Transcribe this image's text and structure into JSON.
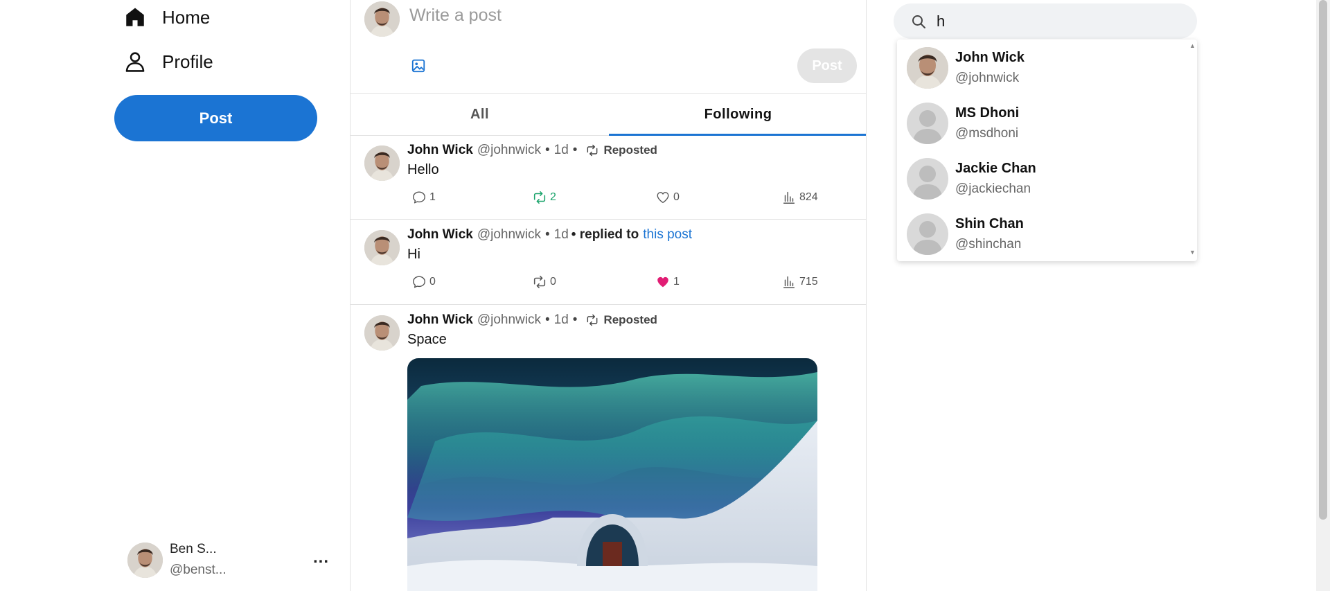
{
  "nav": {
    "home_label": "Home",
    "profile_label": "Profile",
    "post_button": "Post"
  },
  "current_user": {
    "name": "Ben S...",
    "handle": "@benst...",
    "more": "..."
  },
  "composer": {
    "placeholder": "Write a post",
    "post_button": "Post"
  },
  "tabs": [
    {
      "label": "All",
      "active": false
    },
    {
      "label": "Following",
      "active": true
    }
  ],
  "posts": [
    {
      "author": "John Wick",
      "handle": "@johnwick",
      "dot": "•",
      "time": "1d",
      "tag": "Reposted",
      "body": "Hello",
      "replies": "1",
      "reposts": "2",
      "likes": "0",
      "views": "824"
    },
    {
      "author": "John Wick",
      "handle": "@johnwick",
      "dot": "•",
      "time": "1d",
      "reply_text": "• replied to",
      "reply_link": "this post",
      "body": "Hi",
      "replies": "0",
      "reposts": "0",
      "likes": "1",
      "views": "715"
    },
    {
      "author": "John Wick",
      "handle": "@johnwick",
      "dot": "•",
      "time": "1d",
      "tag": "Reposted",
      "body": "Space"
    }
  ],
  "search": {
    "query": "h",
    "results": [
      {
        "name": "John Wick",
        "handle": "@johnwick"
      },
      {
        "name": "MS Dhoni",
        "handle": "@msdhoni"
      },
      {
        "name": "Jackie Chan",
        "handle": "@jackiechan"
      },
      {
        "name": "Shin Chan",
        "handle": "@shinchan"
      }
    ]
  },
  "colors": {
    "accent": "#1b74d3",
    "repost_active": "#1aa36b",
    "like_active": "#e11d74"
  },
  "icons": [
    "home-icon",
    "profile-icon",
    "image-icon",
    "reply-icon",
    "repost-icon",
    "heart-icon",
    "views-icon",
    "search-icon"
  ]
}
